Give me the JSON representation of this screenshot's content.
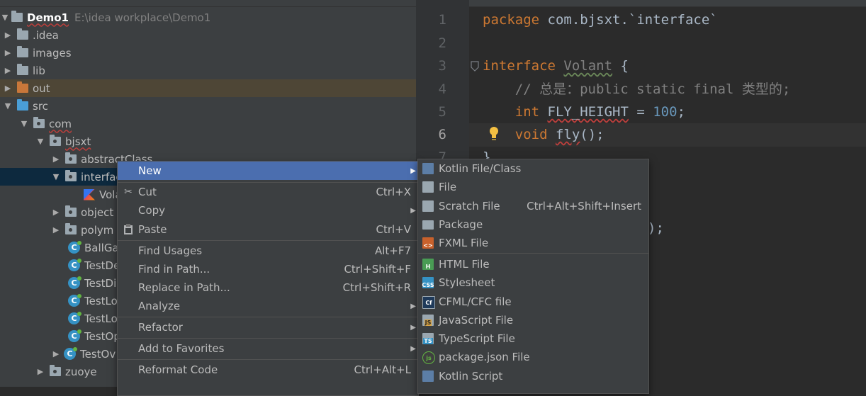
{
  "project": {
    "root": {
      "name": "Demo1",
      "path": "E:\\idea workplace\\Demo1"
    },
    "items": [
      {
        "label": ".idea"
      },
      {
        "label": "images"
      },
      {
        "label": "lib"
      },
      {
        "label": "out"
      },
      {
        "label": "src"
      },
      {
        "label": "com"
      },
      {
        "label": "bjsxt"
      },
      {
        "label": "abstractClass"
      },
      {
        "label": "interface"
      },
      {
        "label": "Volant"
      },
      {
        "label": "object"
      },
      {
        "label": "polym"
      },
      {
        "label": "BallGa"
      },
      {
        "label": "TestDe"
      },
      {
        "label": "TestDi"
      },
      {
        "label": "TestLo"
      },
      {
        "label": "TestLo"
      },
      {
        "label": "TestOp"
      },
      {
        "label": "TestOv"
      },
      {
        "label": "zuoye"
      }
    ]
  },
  "editor": {
    "line_numbers": [
      "1",
      "2",
      "3",
      "4",
      "5",
      "6",
      "7"
    ],
    "current_line": "6",
    "lines": {
      "l1_kw": "package",
      "l1_rest": " com.bjsxt.`interface`",
      "l3_kw": "interface",
      "l3_name": "Volant",
      "l3_rest": " {",
      "l4": "    // 总是：public static final 类型的;",
      "l5_a": "    int ",
      "l5_b": "FLY_HEIGHT",
      "l5_c": " = ",
      "l5_num": "100",
      "l5_d": ";",
      "l6_a": "    void ",
      "l6_b": "fly",
      "l6_c": "();",
      "l7": "}",
      "frag": ");"
    }
  },
  "context_menu": {
    "items": [
      {
        "label": "New",
        "shortcut": ""
      },
      {
        "label": "Cut",
        "shortcut": "Ctrl+X"
      },
      {
        "label": "Copy",
        "shortcut": ""
      },
      {
        "label": "Paste",
        "shortcut": "Ctrl+V"
      },
      {
        "label": "Find Usages",
        "shortcut": "Alt+F7"
      },
      {
        "label": "Find in Path...",
        "shortcut": "Ctrl+Shift+F"
      },
      {
        "label": "Replace in Path...",
        "shortcut": "Ctrl+Shift+R"
      },
      {
        "label": "Analyze",
        "shortcut": ""
      },
      {
        "label": "Refactor",
        "shortcut": ""
      },
      {
        "label": "Add to Favorites",
        "shortcut": ""
      },
      {
        "label": "Reformat Code",
        "shortcut": "Ctrl+Alt+L"
      }
    ]
  },
  "submenu": {
    "items": [
      {
        "label": "Kotlin File/Class",
        "shortcut": ""
      },
      {
        "label": "File",
        "shortcut": ""
      },
      {
        "label": "Scratch File",
        "shortcut": "Ctrl+Alt+Shift+Insert"
      },
      {
        "label": "Package",
        "shortcut": ""
      },
      {
        "label": "FXML File",
        "shortcut": ""
      },
      {
        "label": "HTML File",
        "shortcut": ""
      },
      {
        "label": "Stylesheet",
        "shortcut": ""
      },
      {
        "label": "CFML/CFC file",
        "shortcut": ""
      },
      {
        "label": "JavaScript File",
        "shortcut": ""
      },
      {
        "label": "TypeScript File",
        "shortcut": ""
      },
      {
        "label": "package.json File",
        "shortcut": ""
      },
      {
        "label": "Kotlin Script",
        "shortcut": ""
      }
    ]
  },
  "colors": {
    "selection": "#4b6eaf",
    "panel": "#3c3f41",
    "editor_bg": "#2b2b2b",
    "keyword": "#cc7832",
    "number": "#6897bb"
  }
}
